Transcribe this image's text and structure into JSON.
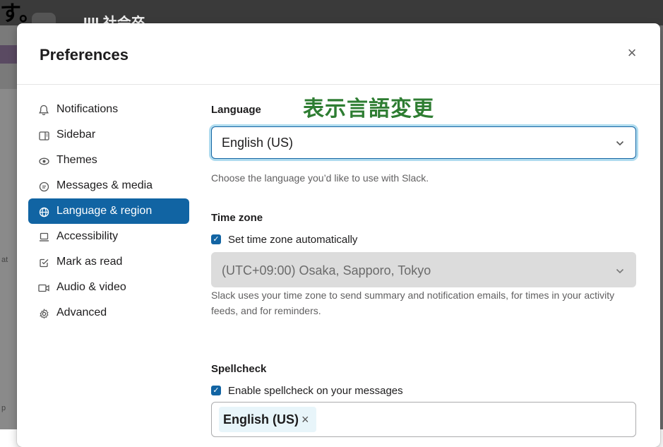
{
  "background": {
    "top_text": "す。",
    "channel": "IIII 社会卒",
    "side_text_1": "at",
    "side_text_2": "p"
  },
  "modal": {
    "title": "Preferences",
    "close": "×"
  },
  "sidebar": {
    "items": [
      {
        "label": "Notifications",
        "icon": "bell-icon",
        "glyph": "🔔︎"
      },
      {
        "label": "Sidebar",
        "icon": "sidebar-icon",
        "glyph": "▥"
      },
      {
        "label": "Themes",
        "icon": "eye-icon",
        "glyph": "◉"
      },
      {
        "label": "Messages & media",
        "icon": "message-icon",
        "glyph": "◙"
      },
      {
        "label": "Language & region",
        "icon": "globe-icon",
        "glyph": "⊕"
      },
      {
        "label": "Accessibility",
        "icon": "laptop-icon",
        "glyph": "▭"
      },
      {
        "label": "Mark as read",
        "icon": "check-message-icon",
        "glyph": "☑"
      },
      {
        "label": "Audio & video",
        "icon": "video-icon",
        "glyph": "▷"
      },
      {
        "label": "Advanced",
        "icon": "gear-icon",
        "glyph": "⚙"
      }
    ],
    "active_index": 4
  },
  "annotation": "表示言語変更",
  "language": {
    "label": "Language",
    "value": "English (US)",
    "help": "Choose the language you’d like to use with Slack."
  },
  "timezone": {
    "label": "Time zone",
    "auto_label": "Set time zone automatically",
    "auto_checked": true,
    "value": "(UTC+09:00) Osaka, Sapporo, Tokyo",
    "help": "Slack uses your time zone to send summary and notification emails, for times in your activity feeds, and for reminders."
  },
  "spellcheck": {
    "label": "Spellcheck",
    "enable_label": "Enable spellcheck on your messages",
    "enable_checked": true,
    "tokens": [
      {
        "label": "English (US)",
        "remove": "×"
      }
    ]
  },
  "colors": {
    "accent": "#1264a3",
    "active_bg": "#1164a3",
    "annotation": "#2e7d32"
  }
}
